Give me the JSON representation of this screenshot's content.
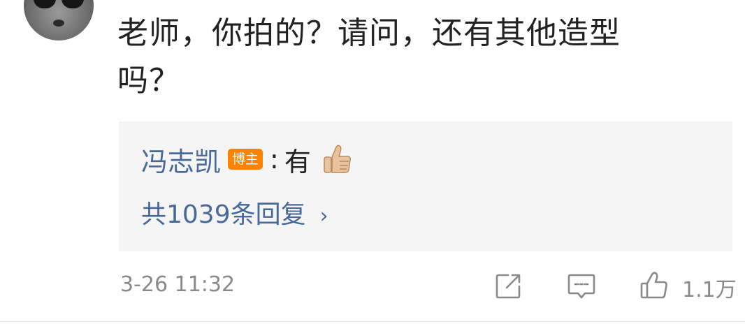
{
  "comment": {
    "text_line1": "老师，你拍的？请问，还有其他造型",
    "text_line2": "吗？",
    "timestamp": "3-26 11:32",
    "like_count": "1.1万"
  },
  "reply": {
    "author": "冯志凯",
    "badge": "博主",
    "separator": ":",
    "content": "有",
    "emoji": "thumbs-up-emoji",
    "more_replies": "共1039条回复",
    "chevron": "›"
  },
  "icons": {
    "share": "share-icon",
    "comment": "comment-icon",
    "like": "like-icon"
  },
  "colors": {
    "link_blue": "#47699b",
    "badge_orange": "#ff8200",
    "reply_bg": "#f5f5f5",
    "meta_gray": "#8a8a8a"
  }
}
